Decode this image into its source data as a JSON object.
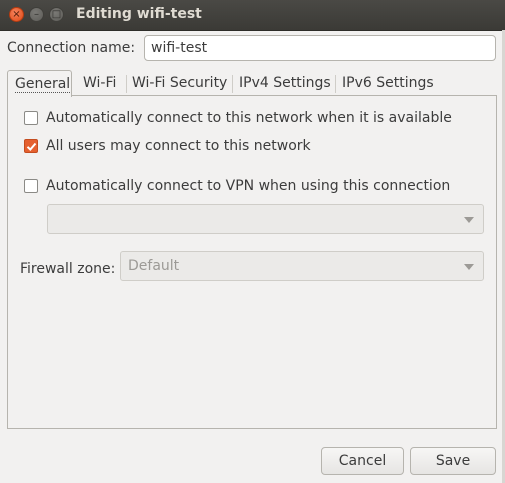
{
  "window": {
    "title": "Editing wifi-test",
    "close_glyph": "×",
    "minimize_glyph": "–",
    "maximize_glyph": "□"
  },
  "connection": {
    "label": "Connection name:",
    "value": "wifi-test"
  },
  "tabs": [
    {
      "label": "General",
      "active": true
    },
    {
      "label": "Wi-Fi",
      "active": false
    },
    {
      "label": "Wi-Fi Security",
      "active": false
    },
    {
      "label": "IPv4 Settings",
      "active": false
    },
    {
      "label": "IPv6 Settings",
      "active": false
    }
  ],
  "general": {
    "auto_connect": {
      "label": "Automatically connect to this network when it is available",
      "checked": false
    },
    "all_users": {
      "label": "All users may connect to this network",
      "checked": true
    },
    "auto_vpn": {
      "label": "Automatically connect to VPN when using this connection",
      "checked": false
    },
    "vpn_select": {
      "value": ""
    },
    "firewall": {
      "label": "Firewall zone:",
      "value": "Default"
    }
  },
  "buttons": {
    "cancel": "Cancel",
    "save": "Save"
  },
  "colors": {
    "accent": "#e5602f",
    "titlebar": "#3b3a36",
    "background": "#f2f1f0"
  }
}
